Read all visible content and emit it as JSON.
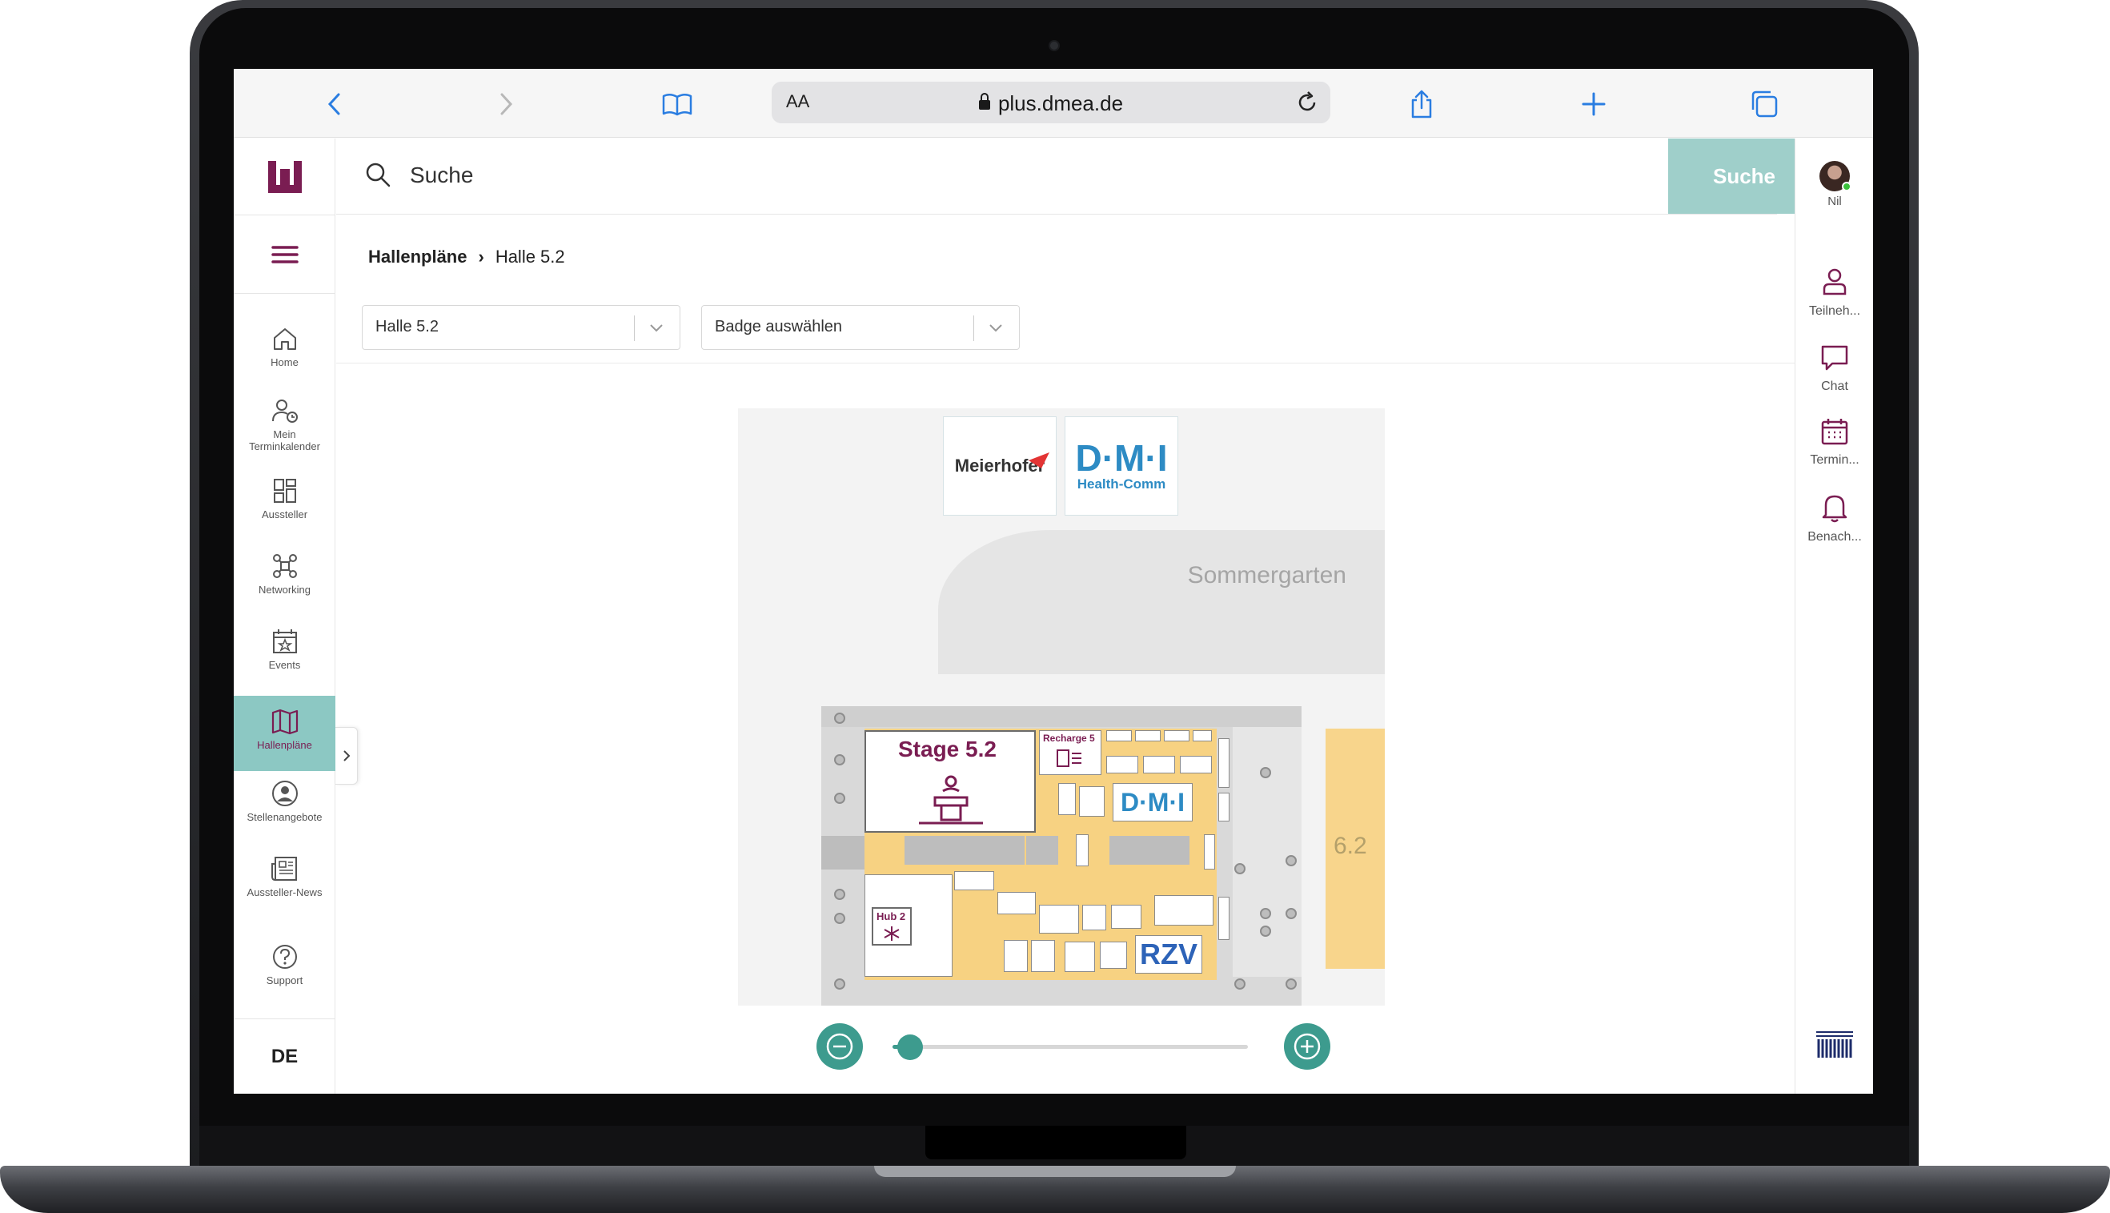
{
  "browser": {
    "url": "plus.dmea.de",
    "reader_label": "AA"
  },
  "search": {
    "placeholder": "Suche",
    "button_label": "Suche"
  },
  "sidebar": {
    "items": [
      {
        "label": "Home"
      },
      {
        "label": "Mein Terminkalender"
      },
      {
        "label": "Aussteller"
      },
      {
        "label": "Networking"
      },
      {
        "label": "Events"
      },
      {
        "label": "Hallenpläne"
      },
      {
        "label": "Stellenangebote"
      },
      {
        "label": "Aussteller-News"
      },
      {
        "label": "Support"
      }
    ],
    "language": "DE"
  },
  "right_sidebar": {
    "user_name": "Nil",
    "items": [
      {
        "label": "Teilneh..."
      },
      {
        "label": "Chat"
      },
      {
        "label": "Termin..."
      },
      {
        "label": "Benach..."
      }
    ]
  },
  "breadcrumb": {
    "parent": "Hallenpläne",
    "current": "Halle 5.2"
  },
  "filters": {
    "hall_select": "Halle 5.2",
    "badge_select": "Badge auswählen"
  },
  "map": {
    "sponsor_1": "Meierhofer",
    "sponsor_2": "D·M·I",
    "sponsor_2_sub": "Health-Comm",
    "area_label": "Sommergarten",
    "stage_label": "Stage 5.2",
    "recharge_label": "Recharge 5",
    "hub_label": "Hub 2",
    "dmi_booth": "D·M·I",
    "rzv_booth": "RZV",
    "neighbor_hall": "6.2"
  },
  "zoom": {
    "level": 0.05
  },
  "colors": {
    "brand": "#7a1d52",
    "accent": "#3d9b8e",
    "active_nav": "#8cc8c3",
    "search_button": "#9fcfca",
    "booth_area": "#f7d282"
  }
}
